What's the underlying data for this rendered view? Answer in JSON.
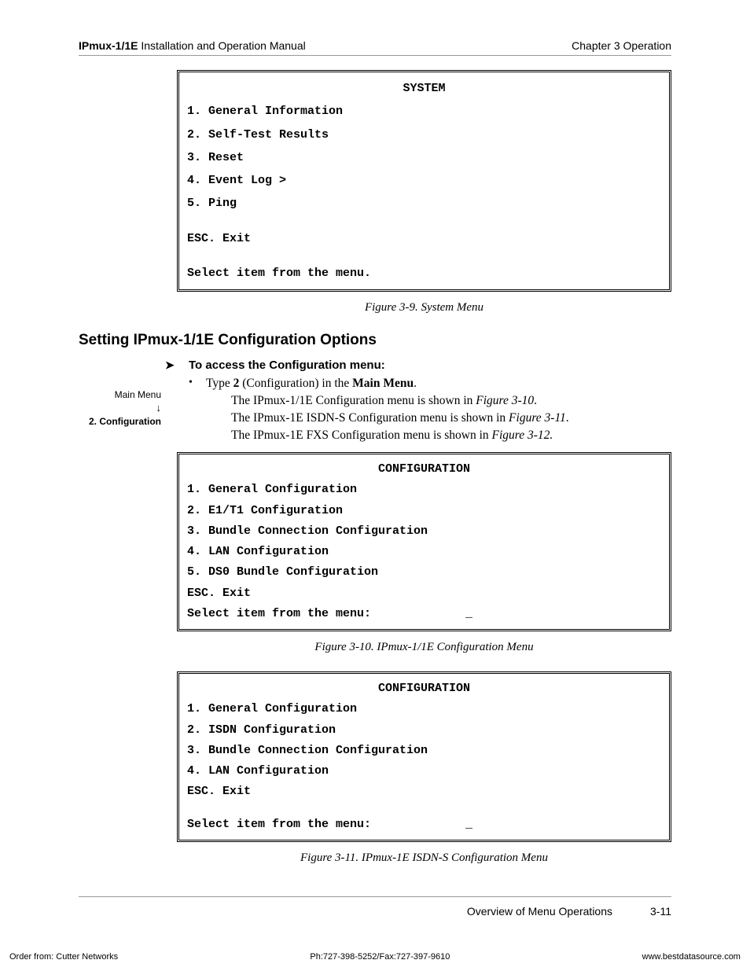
{
  "header": {
    "left_bold": "IPmux-1/1E",
    "left_rest": " Installation and Operation Manual",
    "right": "Chapter 3  Operation"
  },
  "terminal_system": {
    "title": "SYSTEM",
    "items": [
      "1. General Information",
      "2. Self-Test Results",
      "3. Reset",
      "4. Event Log  >",
      "5. Ping"
    ],
    "esc": "ESC.  Exit",
    "prompt": "Select item from the menu."
  },
  "caption_1": "Figure 3-9.  System Menu",
  "section_heading": "Setting IPmux-1/1E Configuration Options",
  "procedure": {
    "arrow": "➤",
    "title": "To access the Configuration menu:",
    "bullet": "•",
    "bullet_pre": "Type ",
    "bullet_bold1": "2",
    "bullet_mid": " (Configuration) in the ",
    "bullet_bold2": "Main Menu",
    "bullet_post": "."
  },
  "sub_paras": [
    {
      "pre": "The IPmux-1/1E Configuration menu is shown in ",
      "em": "Figure 3-10",
      "post": "."
    },
    {
      "pre": "The IPmux-1E ISDN-S Configuration menu is shown in ",
      "em": "Figure 3-11",
      "post": "."
    },
    {
      "pre": "The IPmux-1E FXS Configuration menu is shown in ",
      "em": "Figure 3-12.",
      "post": ""
    }
  ],
  "sidebar": {
    "line1": "Main Menu",
    "arrow": "↓",
    "line2": "2. Configuration"
  },
  "terminal_config_1": {
    "title": "CONFIGURATION",
    "items": [
      "1. General Configuration",
      "2. E1/T1 Configuration",
      "3. Bundle Connection Configuration",
      "4. LAN Configuration",
      "5. DS0 Bundle Configuration"
    ],
    "esc": "ESC. Exit",
    "prompt_pre": "Select item from the menu:",
    "cursor": "_"
  },
  "caption_2": "Figure 3-10.  IPmux-1/1E Configuration Menu",
  "terminal_config_2": {
    "title": "CONFIGURATION",
    "items": [
      "1. General Configuration",
      "2. ISDN Configuration",
      "3. Bundle Connection Configuration",
      "4. LAN Configuration"
    ],
    "esc": "ESC. Exit",
    "prompt_pre": "Select item from the menu:",
    "cursor": "_"
  },
  "caption_3": "Figure 3-11.  IPmux-1E ISDN-S Configuration Menu",
  "footer_section": "Overview of Menu Operations",
  "footer_page": "3-11",
  "bottom": {
    "left": "Order from: Cutter Networks",
    "center": "Ph:727-398-5252/Fax:727-397-9610",
    "right": "www.bestdatasource.com"
  }
}
